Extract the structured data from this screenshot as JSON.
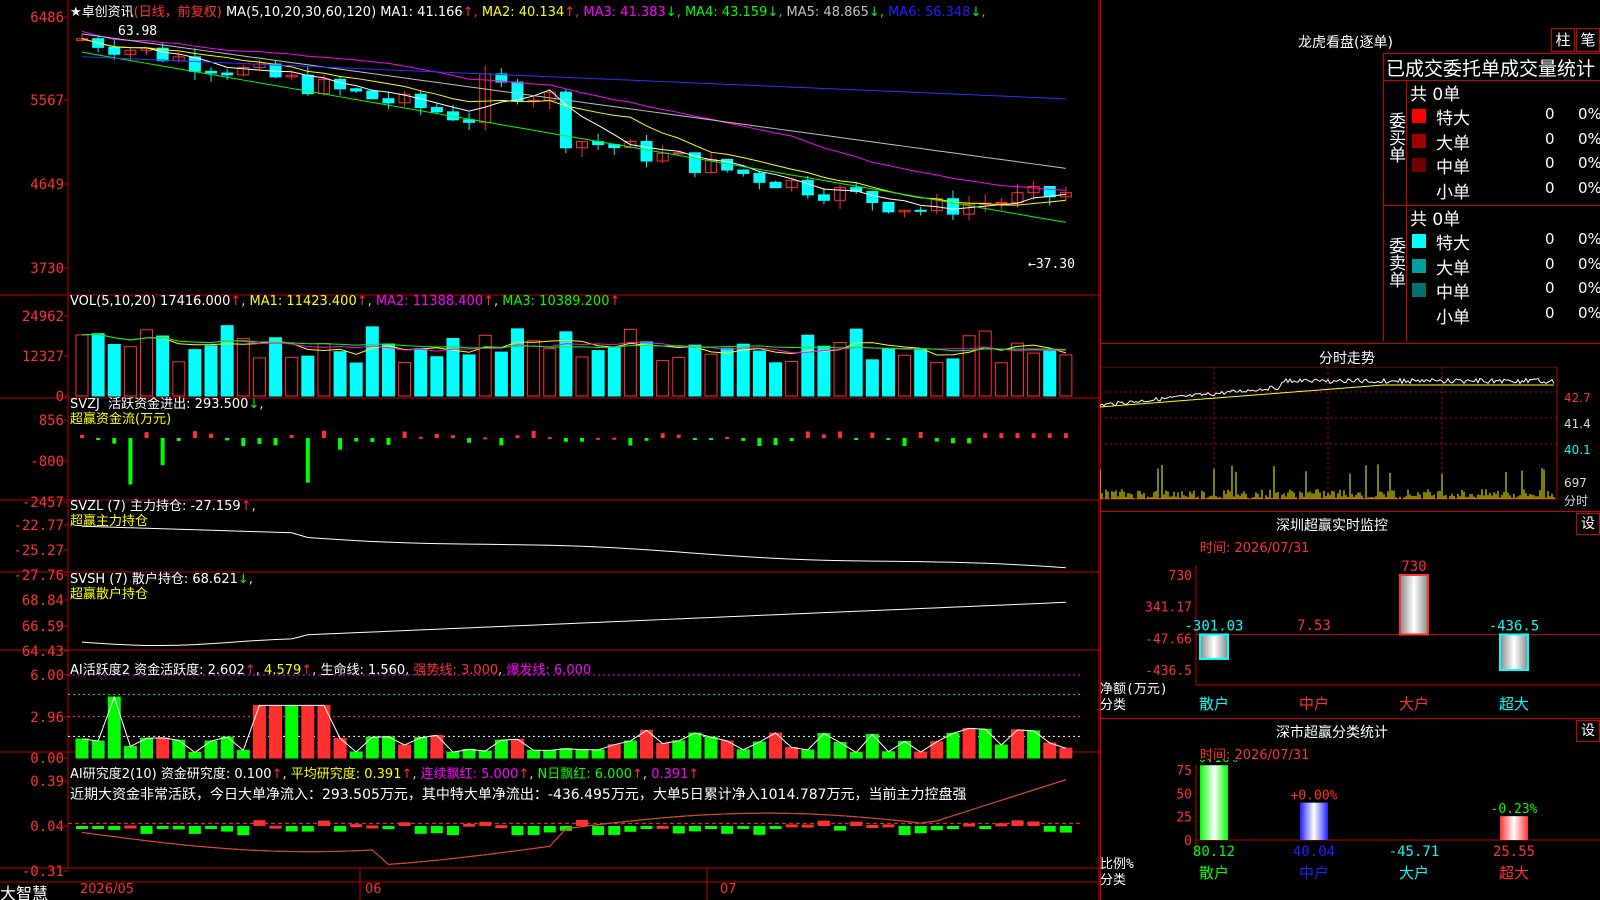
{
  "colors": {
    "up": "#ff3030",
    "down": "#00ffff",
    "border": "#c00000",
    "white": "#ffffff",
    "yellow": "#ffff00",
    "magenta": "#ff00ff",
    "green": "#00ff00",
    "blue": "#2020ff",
    "gray": "#9a9a9a"
  },
  "main": {
    "title_star": "★",
    "title": "卓创资讯",
    "title_mode": "(日线，前复权)",
    "ma_params": "MA(5,10,20,30,60,120)",
    "ma": [
      {
        "label": "MA1: 41.166",
        "arrow": "↑",
        "color": "#ffffff"
      },
      {
        "label": "MA2: 40.134",
        "arrow": "↑",
        "color": "#ffff00"
      },
      {
        "label": "MA3: 41.383",
        "arrow": "↓",
        "color": "#ff00ff"
      },
      {
        "label": "MA4: 43.159",
        "arrow": "↓",
        "color": "#00ff00"
      },
      {
        "label": "MA5: 48.865",
        "arrow": "↓",
        "color": "#c0c0c0"
      },
      {
        "label": "MA6: 56.348",
        "arrow": "↓",
        "color": "#2020ff"
      }
    ],
    "yaxis": [
      "6486",
      "5567",
      "4649",
      "3730"
    ],
    "high_label": "63.98",
    "low_label": "←37.30"
  },
  "vol": {
    "label": "VOL(5,10,20)",
    "value": "17416.000",
    "ma1": "MA1: 11423.400",
    "ma2": "MA2: 11388.400",
    "ma3": "MA3: 10389.200",
    "yaxis": [
      "24962",
      "12327",
      "0"
    ]
  },
  "svzj": {
    "label": "SVZJ",
    "desc": "活跃资金进出: 293.500",
    "arrow": "↓",
    "sub": "超赢资金流(万元)",
    "yaxis": [
      "856",
      "-800",
      "-2457"
    ]
  },
  "svzl": {
    "label": "SVZL (7)",
    "desc": "主力持仓: -27.159",
    "arrow": "↑",
    "sub": "超赢主力持仓",
    "yaxis": [
      "-22.77",
      "-25.27",
      "-27.76"
    ]
  },
  "svsh": {
    "label": "SVSH (7)",
    "desc": "散户持仓: 68.621",
    "arrow": "↓",
    "sub": "超赢散户持仓",
    "yaxis": [
      "68.84",
      "66.59",
      "64.43"
    ]
  },
  "ai1": {
    "label": "AI活跃度2",
    "desc1": "资金活跃度: 2.602",
    "desc2": "4.579",
    "desc3": "生命线: 1.560",
    "desc4": "强势线: 3.000",
    "desc5": "爆发线: 6.000",
    "yaxis": [
      "6.00",
      "2.96",
      "0.00"
    ]
  },
  "ai2": {
    "label": "AI研究度2(10)",
    "desc1": "资金研究度: 0.100",
    "desc2": "平均研究度: 0.391",
    "desc3": "连续飘红: 5.000",
    "desc4": "N日飘红: 6.000",
    "desc5": "0.391",
    "summary": "近期大资金非常活跃，今日大单净流入：293.505万元，其中特大单净流出：-436.495万元，大单5日累计净入1014.787万元，当前主力控盘强",
    "yaxis": [
      "0.39",
      "0.04",
      "-0.31"
    ]
  },
  "dates": {
    "brand": "大智慧",
    "d1": "2026/05",
    "d2": "06",
    "d3": "07"
  },
  "lhb": {
    "title": "龙虎看盘(逐单)",
    "tab1": "柱",
    "tab2": "笔",
    "stat_title": "已成交委托单成交量统计",
    "buy_side": "委买单",
    "sell_side": "委卖单",
    "buy_total": "共 0单",
    "sell_total": "共 0单",
    "buy_rows": [
      {
        "name": "特大",
        "count": "0",
        "pct": "0%",
        "color": "#ff0000"
      },
      {
        "name": "大单",
        "count": "0",
        "pct": "0%",
        "color": "#a00000"
      },
      {
        "name": "中单",
        "count": "0",
        "pct": "0%",
        "color": "#700000"
      },
      {
        "name": "小单",
        "count": "0",
        "pct": "0%",
        "color": "#000000"
      }
    ],
    "sell_rows": [
      {
        "name": "特大",
        "count": "0",
        "pct": "0%",
        "color": "#00ffff"
      },
      {
        "name": "大单",
        "count": "0",
        "pct": "0%",
        "color": "#00a0a0"
      },
      {
        "name": "中单",
        "count": "0",
        "pct": "0%",
        "color": "#007070"
      },
      {
        "name": "小单",
        "count": "0",
        "pct": "0%",
        "color": "#000000"
      }
    ]
  },
  "intraday": {
    "title": "分时走势",
    "y1": "42.7",
    "y2": "41.4",
    "y3": "40.1",
    "vol": "697",
    "unit": "分时"
  },
  "monitor": {
    "title": "深圳超赢实时监控",
    "set": "设",
    "time": "时间: 2026/07/31",
    "yaxis": [
      "730",
      "341.17",
      "-47.66",
      "-436.5"
    ],
    "ylabel1": "净额(万元)",
    "ylabel2": "分类",
    "cats": [
      "散户",
      "中户",
      "大户",
      "超大"
    ],
    "values": [
      -301.03,
      7.53,
      730,
      -436.5
    ],
    "value_labels": [
      "-301.03",
      "7.53",
      "730",
      "-436.5"
    ]
  },
  "classify": {
    "title": "深市超赢分类统计",
    "set": "设",
    "time": "时间: 2026/07/31",
    "yaxis": [
      "75",
      "50",
      "25",
      "0"
    ],
    "ylabel1": "比例%",
    "ylabel2": "分类",
    "cats": [
      "散户",
      "中户",
      "大户",
      "超大"
    ],
    "top_labels": [
      "-0.16%",
      "+0.00%",
      "",
      "-0.23%"
    ],
    "bottom_labels": [
      "80.12",
      "40.04",
      "-45.71",
      "25.55"
    ],
    "values": [
      80.12,
      40.04,
      0,
      25.55
    ]
  }
}
